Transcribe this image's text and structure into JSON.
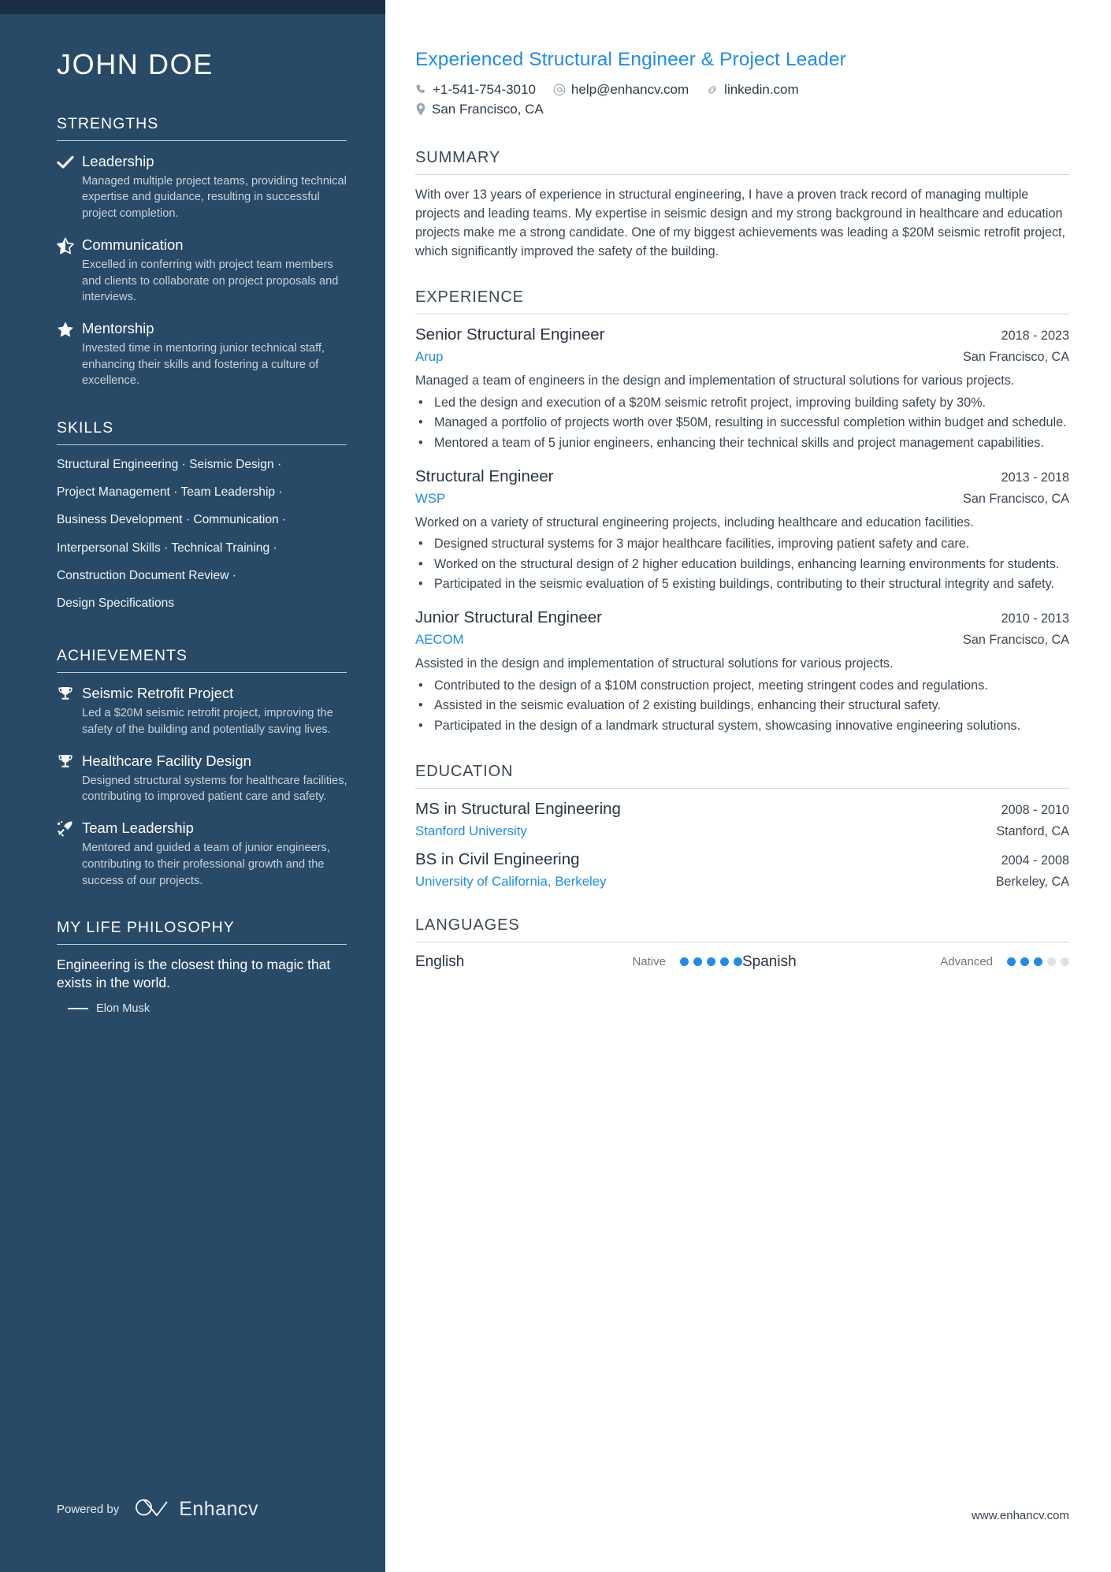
{
  "sidebar": {
    "name": "JOHN DOE",
    "strengths": {
      "title": "STRENGTHS",
      "items": [
        {
          "icon": "check-icon",
          "title": "Leadership",
          "desc": "Managed multiple project teams, providing technical expertise and guidance, resulting in successful project completion."
        },
        {
          "icon": "half-star-icon",
          "title": "Communication",
          "desc": "Excelled in conferring with project team members and clients to collaborate on project proposals and interviews."
        },
        {
          "icon": "star-icon",
          "title": "Mentorship",
          "desc": "Invested time in mentoring junior technical staff, enhancing their skills and fostering a culture of excellence."
        }
      ]
    },
    "skills": {
      "title": "SKILLS",
      "lines": [
        [
          "Structural Engineering",
          "Seismic Design"
        ],
        [
          "Project Management",
          "Team Leadership"
        ],
        [
          "Business Development",
          "Communication"
        ],
        [
          "Interpersonal Skills",
          "Technical Training"
        ],
        [
          "Construction Document Review"
        ],
        [
          "Design Specifications"
        ]
      ]
    },
    "achievements": {
      "title": "ACHIEVEMENTS",
      "items": [
        {
          "icon": "trophy-icon",
          "title": "Seismic Retrofit Project",
          "desc": "Led a $20M seismic retrofit project, improving the safety of the building and potentially saving lives."
        },
        {
          "icon": "trophy-icon",
          "title": "Healthcare Facility Design",
          "desc": "Designed structural systems for healthcare facilities, contributing to improved patient care and safety."
        },
        {
          "icon": "rocket-icon",
          "title": "Team Leadership",
          "desc": "Mentored and guided a team of junior engineers, contributing to their professional growth and the success of our projects."
        }
      ]
    },
    "philosophy": {
      "title": "MY LIFE PHILOSOPHY",
      "quote": "Engineering is the closest thing to magic that exists in the world.",
      "author": "Elon Musk"
    },
    "footer": {
      "powered_label": "Powered by",
      "brand": "Enhancv"
    }
  },
  "main": {
    "headline": "Experienced Structural Engineer & Project Leader",
    "contacts": {
      "phone": "+1-541-754-3010",
      "email": "help@enhancv.com",
      "linkedin": "linkedin.com",
      "location": "San Francisco, CA"
    },
    "summary": {
      "title": "SUMMARY",
      "text": "With over 13 years of experience in structural engineering, I have a proven track record of managing multiple projects and leading teams. My expertise in seismic design and my strong background in healthcare and education projects make me a strong candidate. One of my biggest achievements was leading a $20M seismic retrofit project, which significantly improved the safety of the building."
    },
    "experience": {
      "title": "EXPERIENCE",
      "entries": [
        {
          "role": "Senior Structural Engineer",
          "date": "2018 - 2023",
          "company": "Arup",
          "location": "San Francisco, CA",
          "desc": "Managed a team of engineers in the design and implementation of structural solutions for various projects.",
          "bullets": [
            "Led the design and execution of a $20M seismic retrofit project, improving building safety by 30%.",
            "Managed a portfolio of projects worth over $50M, resulting in successful completion within budget and schedule.",
            "Mentored a team of 5 junior engineers, enhancing their technical skills and project management capabilities."
          ]
        },
        {
          "role": "Structural Engineer",
          "date": "2013 - 2018",
          "company": "WSP",
          "location": "San Francisco, CA",
          "desc": "Worked on a variety of structural engineering projects, including healthcare and education facilities.",
          "bullets": [
            "Designed structural systems for 3 major healthcare facilities, improving patient safety and care.",
            "Worked on the structural design of 2 higher education buildings, enhancing learning environments for students.",
            "Participated in the seismic evaluation of 5 existing buildings, contributing to their structural integrity and safety."
          ]
        },
        {
          "role": "Junior Structural Engineer",
          "date": "2010 - 2013",
          "company": "AECOM",
          "location": "San Francisco, CA",
          "desc": "Assisted in the design and implementation of structural solutions for various projects.",
          "bullets": [
            "Contributed to the design of a $10M construction project, meeting stringent codes and regulations.",
            "Assisted in the seismic evaluation of 2 existing buildings, enhancing their structural safety.",
            "Participated in the design of a landmark structural system, showcasing innovative engineering solutions."
          ]
        }
      ]
    },
    "education": {
      "title": "EDUCATION",
      "entries": [
        {
          "degree": "MS in Structural Engineering",
          "date": "2008 - 2010",
          "school": "Stanford University",
          "location": "Stanford, CA"
        },
        {
          "degree": "BS in Civil Engineering",
          "date": "2004 - 2008",
          "school": "University of California, Berkeley",
          "location": "Berkeley, CA"
        }
      ]
    },
    "languages": {
      "title": "LANGUAGES",
      "items": [
        {
          "name": "English",
          "level": "Native",
          "filled": 5,
          "total": 5
        },
        {
          "name": "Spanish",
          "level": "Advanced",
          "filled": 3,
          "total": 5
        }
      ]
    },
    "site_url": "www.enhancv.com"
  },
  "colors": {
    "sidebar_bg": "#284a67",
    "sidebar_topbar": "#1b2f44",
    "accent_blue": "#1f8ceb",
    "text_dark": "#3c4753"
  }
}
